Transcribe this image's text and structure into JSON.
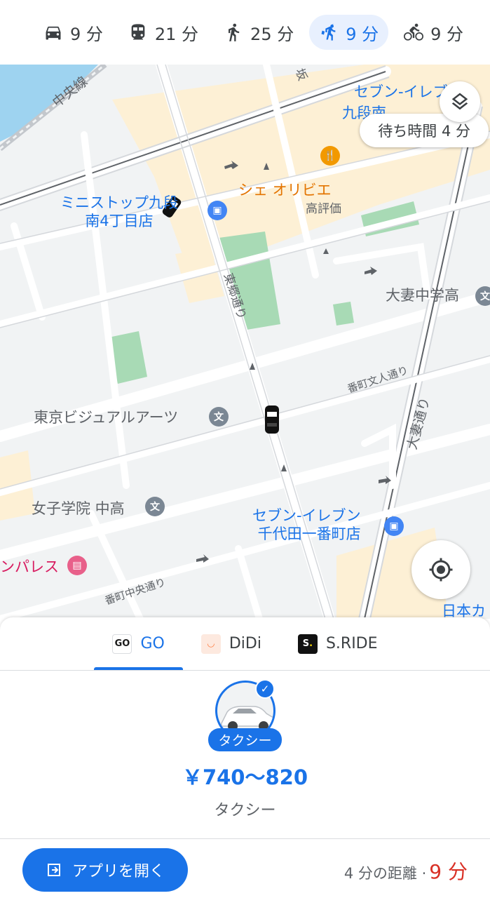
{
  "transport_modes": [
    {
      "icon": "car-icon",
      "label": "9 分",
      "active": false
    },
    {
      "icon": "train-icon",
      "label": "21 分",
      "active": false
    },
    {
      "icon": "walk-icon",
      "label": "25 分",
      "active": false
    },
    {
      "icon": "ride-hail-icon",
      "label": "9 分",
      "active": true
    },
    {
      "icon": "bicycle-icon",
      "label": "9 分",
      "active": false
    }
  ],
  "map": {
    "wait_time": "待ち時間 4 分",
    "labels": {
      "ministop": "ミニストップ九段\n南4丁目店",
      "chez_olivier": "シェ オリビエ",
      "highly_rated": "高評価",
      "seven_top": "セブン-イレブン",
      "seven_top_2": "九段南",
      "otsuma_jh": "大妻中学高",
      "tokyo_visual_arts": "東京ビジュアルアーツ",
      "joshigakuin": "女子学院 中高",
      "seven_bancho": "セブン-イレブン\n千代田一番町店",
      "palace": "ンパレス",
      "nihon": "日本カ",
      "chuo_line": "中央線",
      "togo_dori": "東郷通り",
      "bancho_bunjin": "番町文人通り",
      "otsuma_dori": "大妻通り",
      "bancho_chuo": "番町中央通り",
      "saka": "坂"
    }
  },
  "providers": [
    {
      "name": "GO",
      "icon": "go-logo-icon",
      "active": true
    },
    {
      "name": "DiDi",
      "icon": "didi-logo-icon",
      "active": false
    },
    {
      "name": "S.RIDE",
      "icon": "sride-logo-icon",
      "active": false
    }
  ],
  "taxi": {
    "chip": "タクシー",
    "price": "￥740〜820",
    "name": "タクシー"
  },
  "footer": {
    "open_app": "アプリを開く",
    "eta_prefix": "4 分の距離 ·",
    "eta_minutes": "9 分"
  },
  "colors": {
    "accent": "#1a73e8",
    "eta_red": "#d93025",
    "park_green": "#a8dab5",
    "commercial": "#fdf0d5"
  }
}
